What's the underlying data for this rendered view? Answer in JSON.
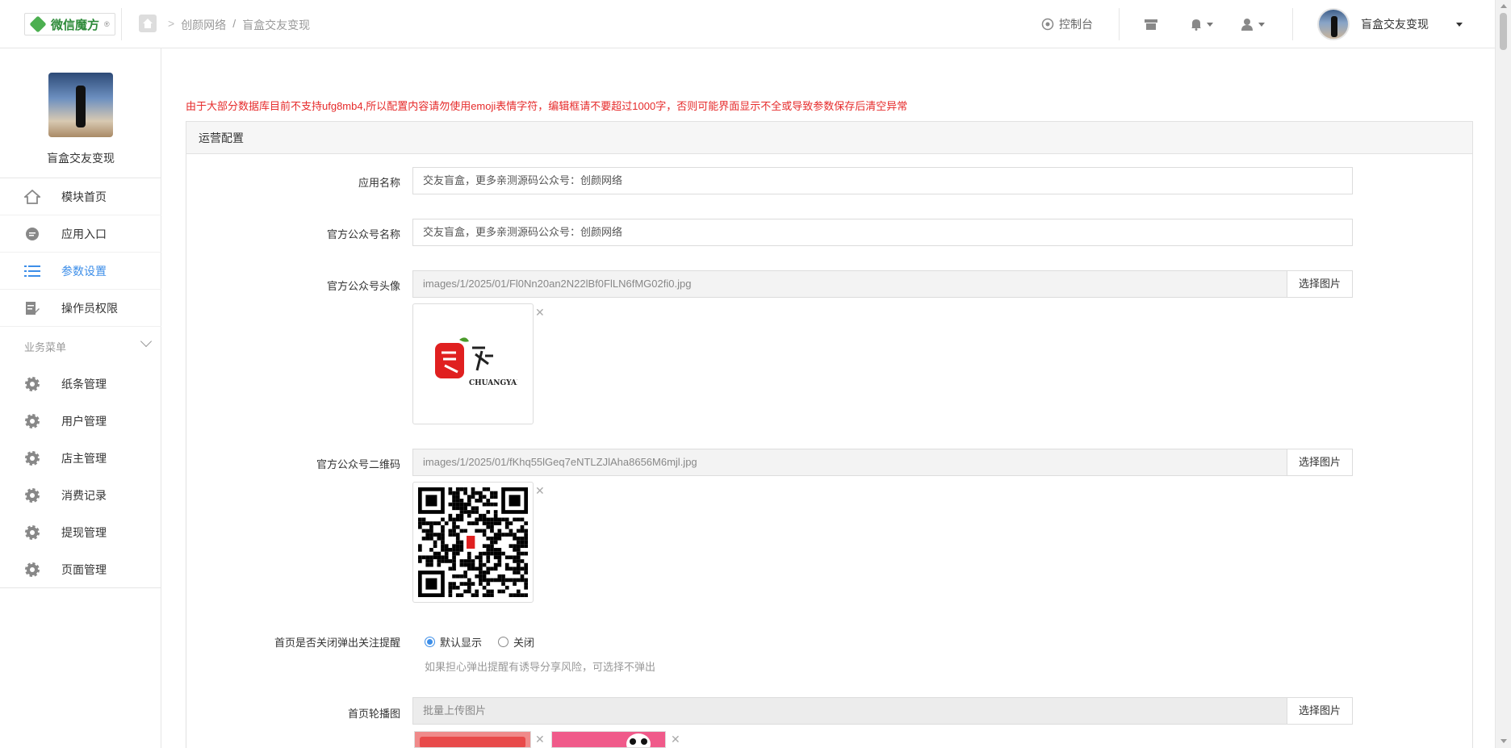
{
  "topbar": {
    "logo_text": "微信魔方",
    "logo_mark": "®",
    "breadcrumb": [
      "创颜网络",
      "/",
      "盲盒交友变现"
    ],
    "console_label": "控制台",
    "account_name": "盲盒交友变现"
  },
  "sidebar": {
    "profile_name": "盲盒交友变现",
    "main_items": [
      {
        "label": "模块首页",
        "icon": "home-icon"
      },
      {
        "label": "应用入口",
        "icon": "chat-icon"
      },
      {
        "label": "参数设置",
        "icon": "list-icon",
        "active": true
      },
      {
        "label": "操作员权限",
        "icon": "edit-doc-icon"
      }
    ],
    "biz_title": "业务菜单",
    "biz_items": [
      {
        "label": "纸条管理"
      },
      {
        "label": "用户管理"
      },
      {
        "label": "店主管理"
      },
      {
        "label": "消费记录"
      },
      {
        "label": "提现管理"
      },
      {
        "label": "页面管理"
      }
    ]
  },
  "main": {
    "warning": "由于大部分数据库目前不支持ufg8mb4,所以配置内容请勿使用emoji表情字符，编辑框请不要超过1000字，否则可能界面显示不全或导致参数保存后清空异常",
    "panel_title": "运营配置",
    "fields": {
      "app_name": {
        "label": "应用名称",
        "value": "交友盲盒，更多亲测源码公众号：创颜网络"
      },
      "mp_name": {
        "label": "官方公众号名称",
        "value": "交友盲盒，更多亲测源码公众号：创颜网络"
      },
      "mp_avatar": {
        "label": "官方公众号头像",
        "value": "images/1/2025/01/Fl0Nn20an2N22lBf0FlLN6fMG02fi0.jpg",
        "button": "选择图片",
        "thumb_text": "CHUANGYAN"
      },
      "mp_qrcode": {
        "label": "官方公众号二维码",
        "value": "images/1/2025/01/fKhq55lGeq7eNTLZJlAha8656M6mjl.jpg",
        "button": "选择图片"
      },
      "follow_popup": {
        "label": "首页是否关闭弹出关注提醒",
        "options": [
          "默认显示",
          "关闭"
        ],
        "selected": "默认显示",
        "help": "如果担心弹出提醒有诱导分享风险，可选择不弹出"
      },
      "banner": {
        "label": "首页轮播图",
        "placeholder": "批量上传图片",
        "button": "选择图片"
      }
    }
  },
  "colors": {
    "accent": "#3d8ee8",
    "warning": "#e62b2b",
    "brand": "#2e8b3a"
  }
}
